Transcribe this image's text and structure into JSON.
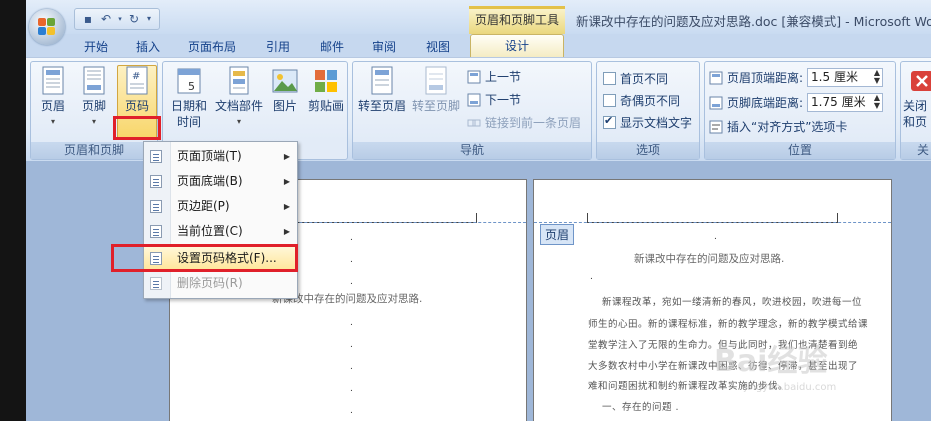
{
  "app": {
    "context_tab_group": "页眉和页脚工具",
    "window_title": "新课改中存在的问题及应对思路.doc [兼容模式] - Microsoft Word"
  },
  "tabs": [
    "开始",
    "插入",
    "页面布局",
    "引用",
    "邮件",
    "审阅",
    "视图"
  ],
  "active_tab": "设计",
  "ribbon": {
    "group1": {
      "label": "页眉和页脚",
      "header": "页眉",
      "footer": "页脚",
      "page_number": "页码"
    },
    "group2": {
      "date_time_1": "日期和",
      "date_time_2": "时间",
      "quick_parts": "文档部件",
      "picture": "图片",
      "clipart": "剪贴画"
    },
    "nav": {
      "label": "导航",
      "goto_header": "转至页眉",
      "goto_footer": "转至页脚",
      "prev": "上一节",
      "next": "下一节",
      "link_prev": "链接到前一条页眉"
    },
    "options": {
      "label": "选项",
      "diff_first": "首页不同",
      "diff_odd_even": "奇偶页不同",
      "show_text": "显示文档文字",
      "show_text_checked": true
    },
    "position": {
      "label": "位置",
      "header_dist_label": "页眉顶端距离:",
      "header_dist": "1.5 厘米",
      "footer_dist_label": "页脚底端距离:",
      "footer_dist": "1.75 厘米",
      "insert_align": "插入“对齐方式”选项卡"
    },
    "close": {
      "label": "关",
      "btn_1": "关闭",
      "btn_2": "和页"
    }
  },
  "menu": {
    "items": [
      {
        "label": "页面顶端(T)",
        "has_sub": true,
        "disabled": false
      },
      {
        "label": "页面底端(B)",
        "has_sub": true,
        "disabled": false
      },
      {
        "label": "页边距(P)",
        "has_sub": true,
        "disabled": false
      },
      {
        "label": "当前位置(C)",
        "has_sub": true,
        "disabled": false
      },
      {
        "label": "设置页码格式(F)...",
        "has_sub": false,
        "disabled": false
      },
      {
        "label": "删除页码(R)",
        "has_sub": false,
        "disabled": true
      }
    ]
  },
  "document": {
    "header_tag": "页眉",
    "title": "新课改中存在的问题及应对思路.",
    "right_lines": [
      "新课程改革，宛如一缕清新的春风，吹进校园，吹进每一位",
      "师生的心田。新的课程标准，新的教学理念，新的教学模式给课",
      "堂教学注入了无限的生命力。但与此同时，我们也清楚看到绝",
      "大多数农村中小学在新课改中困惑、彷徨、停滞，甚至出现了",
      "难和问题困扰和制约新课程改革实施的步伐。",
      "一、存在的问题 ."
    ]
  },
  "watermark": {
    "text": "Bai经验",
    "url": "jingyan.baidu.com"
  }
}
